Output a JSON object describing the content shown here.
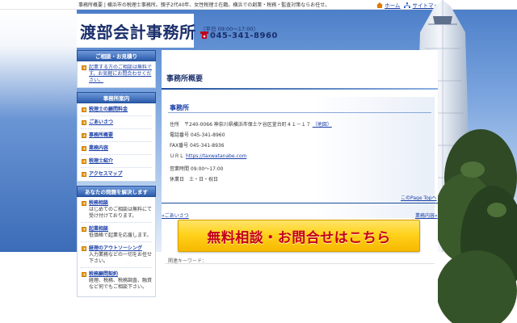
{
  "topbar": {
    "description": "事務所概要 | 横浜市の税理士事務所。親子2代40年、女性税理士在籍。横浜での創業・税務・監査対策ならお任せ。",
    "home_label": "ホーム",
    "sitemap_label": "サイトマップ"
  },
  "header": {
    "site_title": "渡部会計事務所",
    "hours": "（平日 09:00～17:00）",
    "phone": "045-341-8960"
  },
  "sidebar": {
    "consult_heading": "ご相談・お見積り",
    "consult_text": "起業する方のご相談は無料です。お気軽にお問合わせください。",
    "office_heading": "事務所案内",
    "office_items": [
      {
        "label": "税理士の顧問料金"
      },
      {
        "label": "ごあいさつ"
      },
      {
        "label": "事務所概要"
      },
      {
        "label": "業務内容"
      },
      {
        "label": "税理士紹介"
      },
      {
        "label": "アクセスマップ"
      }
    ],
    "solve_heading": "あなたの問題を解決します",
    "solve_items": [
      {
        "label": "税務相談",
        "desc": "はじめてのご相談は無料にて受け付けております。"
      },
      {
        "label": "起業相談",
        "desc": "低価格で起業を応援します。"
      },
      {
        "label": "経理のアウトソーシング",
        "desc": "入力業務などの一切をお任せ下さい。"
      },
      {
        "label": "税務顧問契約",
        "desc": "経理、税務、税務調査、融資など何でもご相談下さい。"
      }
    ]
  },
  "main": {
    "page_heading": "事務所概要",
    "section_title": "事務所",
    "address": "住所　〒240-0066 神奈川県横浜市保土ケ谷区釜台町４１－１７",
    "map_link": "（地図）",
    "tel": "電話番号 045-341-8960",
    "fax": "FAX番号 045-341-8936",
    "url_label": "ＵＲＬ",
    "url": "https://taxwatanabe.com",
    "hours": "営業時間 09:00～17:00",
    "holidays": "休業日　土・日・祝日",
    "page_top": "このPage Topへ",
    "prev": "«ごあいさつ",
    "next": "業務内容»",
    "cta": "無料相談・お問合せはこちら",
    "related": "関連キーワード："
  },
  "colors": {
    "brand_navy": "#1b2f6b",
    "link_blue": "#1a3fa8",
    "cta_yellow": "#ffd21c",
    "cta_red": "#c4001a",
    "side_head_blue": "#2c5bab"
  },
  "icons": [
    "house-icon",
    "sitemap-icon",
    "phone-icon",
    "arrow-bullet-icon"
  ]
}
